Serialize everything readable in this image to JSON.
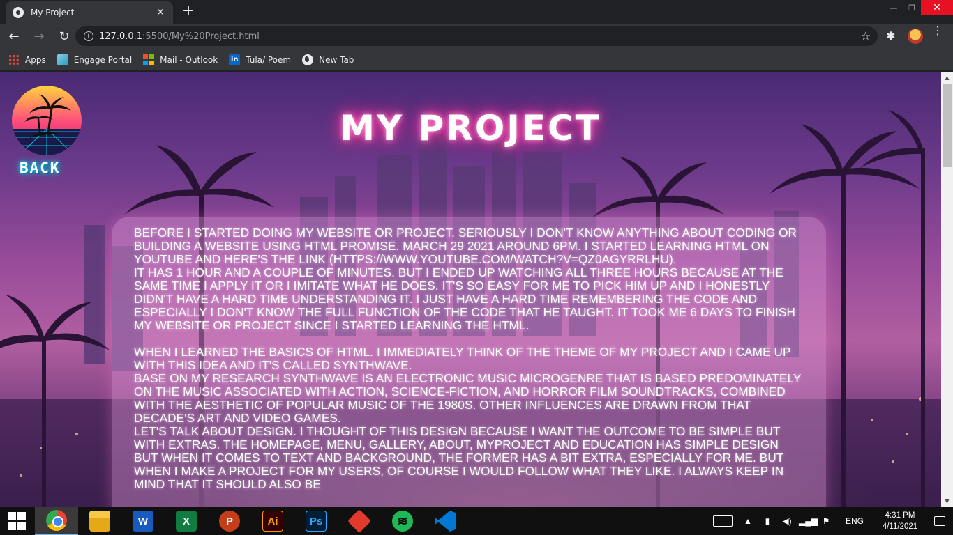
{
  "browser": {
    "tab_title": "My Project",
    "tab_close": "✕",
    "new_tab": "+",
    "url_host": "127.0.0.1",
    "url_path": ":5500/My%20Project.html",
    "bookmarks": [
      "Apps",
      "Engage Portal",
      "Mail - Outlook",
      "Tula/ Poem",
      "New Tab"
    ]
  },
  "page": {
    "back_label": "Back",
    "title": "My Project",
    "paragraphs": [
      "Before I started doing my website or project. Seriously I don't know anything about coding or building a website using HTML promise. March 29 2021 around 6pm. I started learning HTML on YouTube and here's the link (https://www.youtube.com/watch?v=qz0aGYrrlhU).",
      "It has 1 hour and a couple of minutes. But I ended up watching all three hours because at the same time I apply it or I imitate what he does. It's so easy for me to pick him up and I honestly didn't have a hard time understanding it. I just have a hard time remembering the code and especially I don't know the full function of the code that he taught. It took me 6 days to finish my website or project since I started learning the HTML.",
      "When I learned the basics of HTML. I immediately think of the theme of my project and I came up with this idea and it's called Synthwave.",
      "Base on my research Synthwave is an electronic music microgenre that is based predominately on the music associated with action, science-fiction, and horror film soundtracks, combined with the aesthetic of popular music of the 1980s. Other influences are drawn from that decade's art and video games.",
      "Let's talk about design. I thought of this design because I want the outcome to be simple but with extras. The homepage, menu, gallery, about, myproject and education has simple design but when it comes to text and background, the former has a bit extra, especially for me. But when I make a project for my users, of course I would follow what they like. I always keep in mind that it should also be"
    ]
  },
  "taskbar": {
    "apps": [
      "chrome",
      "file-explorer",
      "word",
      "excel",
      "powerpoint",
      "illustrator",
      "photoshop",
      "sketchup",
      "spotify",
      "vscode"
    ],
    "app_glyphs": {
      "word": "W",
      "excel": "X",
      "powerpoint": "P",
      "illustrator": "Ai",
      "photoshop": "Ps",
      "spotify": "≋"
    },
    "language": "ENG",
    "time": "4:31 PM",
    "date": "4/11/2021"
  }
}
